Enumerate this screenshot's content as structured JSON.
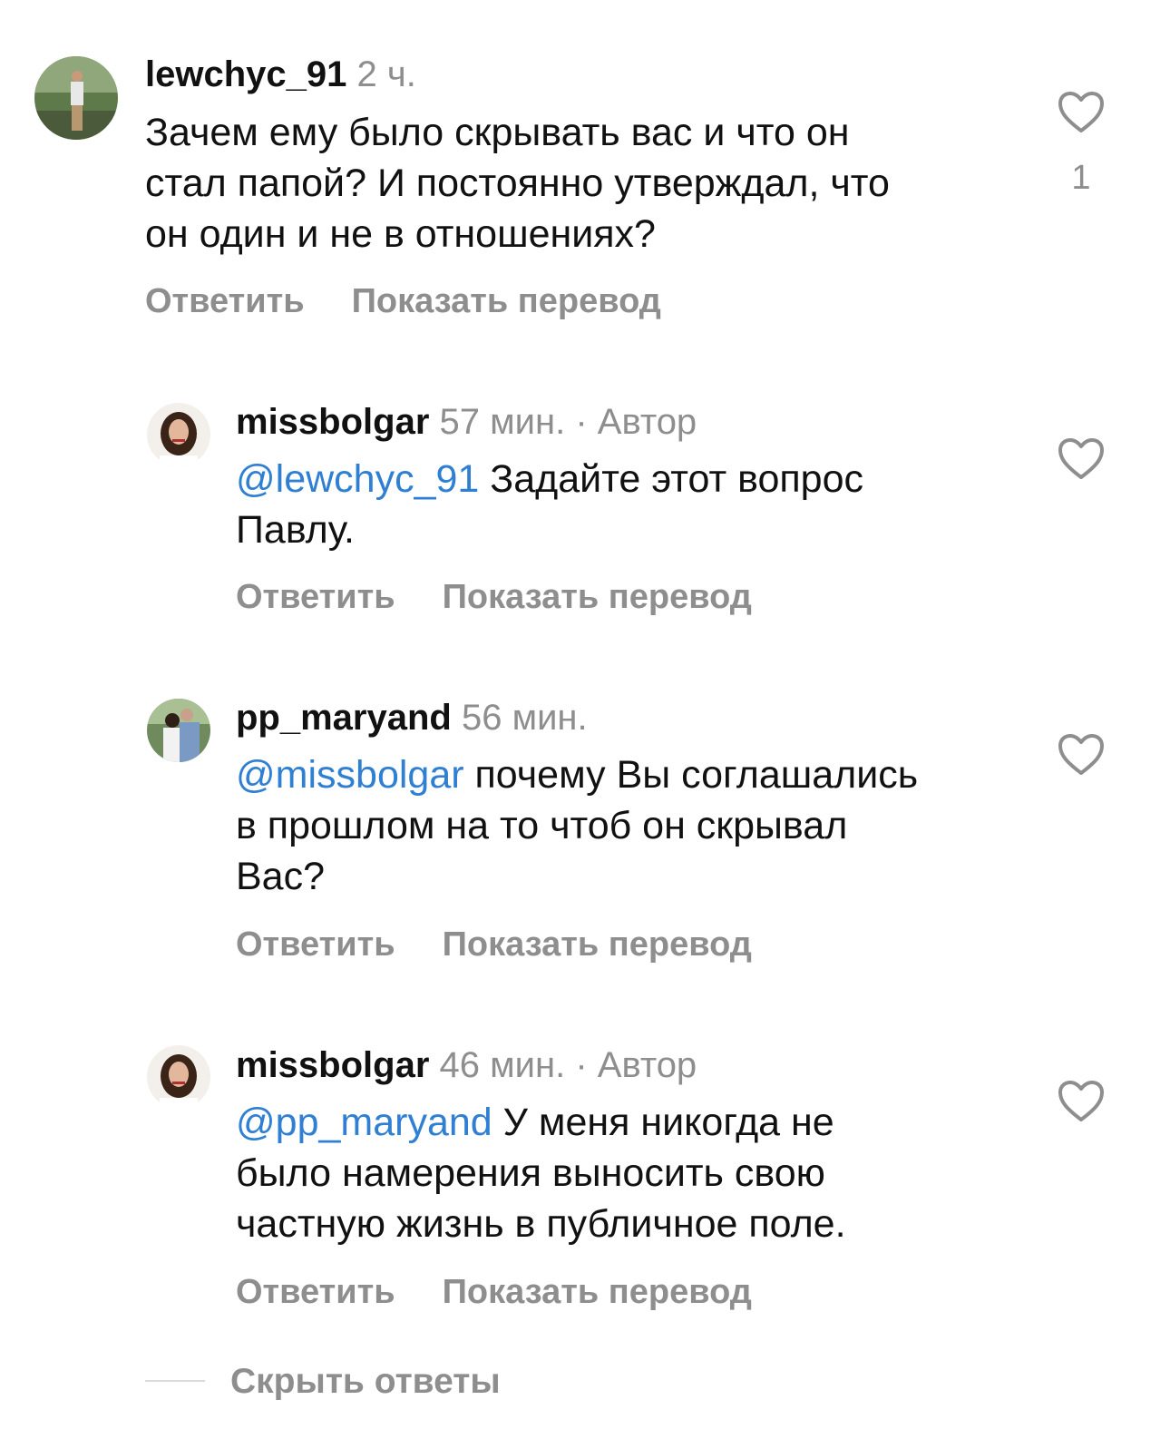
{
  "comments": [
    {
      "username": "lewchyc_91",
      "time": "2 ч.",
      "author_label": "",
      "mention": "",
      "lines": [
        "Зачем ему было скрывать вас и что он",
        "стал папой? И постоянно утверждал, что",
        "он один и не в отношениях?"
      ],
      "reply_label": "Ответить",
      "translate_label": "Показать перевод",
      "like_count": "1",
      "like_icon": "heart-outline-icon"
    },
    {
      "username": "missbolgar",
      "time": "57 мин.",
      "separator": "·",
      "author_label": "Автор",
      "mention": "@lewchyc_91",
      "first_line_rest": " Задайте этот вопрос",
      "lines": [
        "Павлу."
      ],
      "reply_label": "Ответить",
      "translate_label": "Показать перевод",
      "like_icon": "heart-outline-icon"
    },
    {
      "username": "pp_maryand",
      "time": "56 мин.",
      "mention": "@missbolgar",
      "first_line_rest": " почему Вы соглашались",
      "lines": [
        "в прошлом на то чтоб он скрывал",
        "Вас?"
      ],
      "reply_label": "Ответить",
      "translate_label": "Показать перевод",
      "like_icon": "heart-outline-icon"
    },
    {
      "username": "missbolgar",
      "time": "46 мин.",
      "separator": "·",
      "author_label": "Автор",
      "mention": "@pp_maryand",
      "first_line_rest": " У меня никогда не",
      "lines": [
        "было намерения выносить свою",
        "частную жизнь в публичное поле."
      ],
      "reply_label": "Ответить",
      "translate_label": "Показать перевод",
      "like_icon": "heart-outline-icon"
    }
  ],
  "hide_replies_label": "Скрыть ответы",
  "colors": {
    "mention": "#2f7fd2",
    "secondary_text": "#8e8e8e",
    "primary_text": "#111111"
  }
}
